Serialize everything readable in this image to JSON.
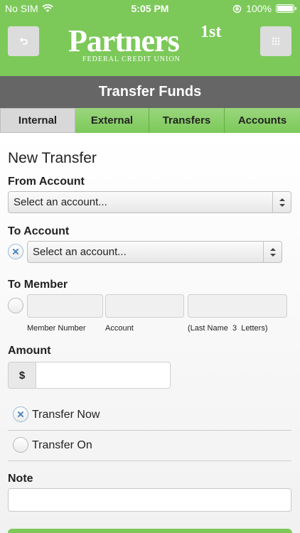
{
  "status_bar": {
    "carrier": "No SIM",
    "time": "5:05 PM",
    "battery": "100%"
  },
  "header": {
    "logo_text": "Partners",
    "logo_superscript": "1st",
    "logo_subtitle": "FEDERAL CREDIT UNION",
    "back_icon": "back-arrow-icon",
    "menu_icon": "grid-menu-icon"
  },
  "title": "Transfer Funds",
  "tabs": [
    {
      "label": "Internal",
      "active": true
    },
    {
      "label": "External",
      "active": false
    },
    {
      "label": "Transfers",
      "active": false
    },
    {
      "label": "Accounts",
      "active": false
    }
  ],
  "form": {
    "heading": "New Transfer",
    "from_account": {
      "label": "From Account",
      "value": "Select an account..."
    },
    "to_account": {
      "label": "To Account",
      "value": "Select an account...",
      "selected": true
    },
    "to_member": {
      "label": "To Member",
      "selected": false,
      "captions": [
        "Member Number",
        "Account",
        "(Last Name  3  Letters)"
      ]
    },
    "amount": {
      "label": "Amount",
      "currency_symbol": "$",
      "value": ""
    },
    "transfer_now": {
      "label": "Transfer Now",
      "selected": true
    },
    "transfer_on": {
      "label": "Transfer On",
      "selected": false
    },
    "note": {
      "label": "Note",
      "value": ""
    }
  },
  "colors": {
    "brand_green": "#7cc95a",
    "title_gray": "#666666",
    "active_tab": "#d8d8d8"
  }
}
